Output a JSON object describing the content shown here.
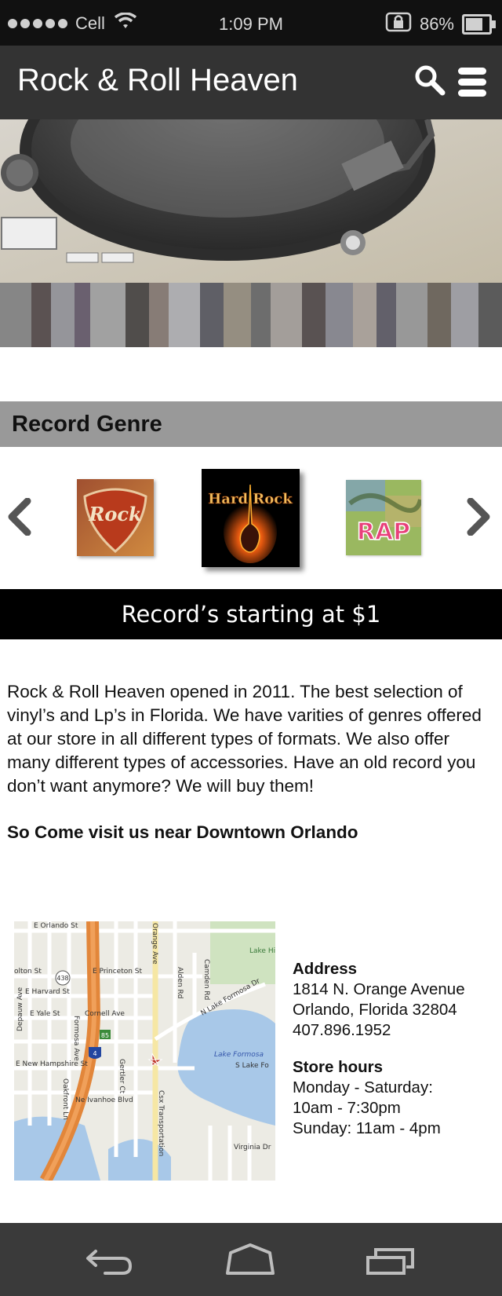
{
  "status_bar": {
    "carrier": "Cell",
    "time": "1:09 PM",
    "battery_percent": "86%",
    "battery_level": 0.86
  },
  "header": {
    "title": "Rock & Roll Heaven"
  },
  "genre": {
    "title": "Record Genre",
    "items": [
      {
        "label": "Rock"
      },
      {
        "label": "Hard Rock"
      },
      {
        "label": "RAP"
      }
    ]
  },
  "promo": {
    "text": "Record’s starting at $1"
  },
  "about": {
    "text": "Rock & Roll Heaven opened in 2011. The best selection of vinyl’s and Lp’s in Florida.  We have varities of genres offered at our store in all different types of formats. We also offer many different types of accessories. Have an old record you don’t want anymore? We will buy them!",
    "cta": "So Come visit us near Downtown Orlando"
  },
  "map": {
    "labels": {
      "e_orlando_st": "E Orlando St",
      "colton_st": "olton St",
      "route_438": "438",
      "e_princeton_st": "E Princeton St",
      "e_harvard_st": "E Harvard St",
      "e_yale_st": "E Yale St",
      "cornell_ave": "Cornell Ave",
      "depauw_ave": "Depauw Ave",
      "formosa_ave": "Formosa Ave",
      "e_new_hampshire_st": "E New Hampshire St",
      "oakfront_ln": "Oakfront Ln",
      "ne_ivanhoe_blvd": "Ne Ivanhoe Blvd",
      "gertler_ct": "Gertler Ct",
      "csx_transportation": "Csx Transportation",
      "orange_ave": "Orange Ave",
      "alden_rd": "Alden Rd",
      "camden_rd": "Camden Rd",
      "n_lake_formosa_dr": "N Lake Formosa Dr",
      "lake_formosa": "Lake Formosa",
      "s_lake_formosa": "S Lake Fo",
      "virginia_dr": "Virginia Dr",
      "lake_highland_prep": "Lake Hi Pa",
      "highway_85": "85",
      "interstate_4": "4"
    }
  },
  "store": {
    "address_heading": "Address",
    "address_line1": "1814 N. Orange Avenue",
    "address_line2": "Orlando, Florida 32804",
    "phone": "407.896.1952",
    "hours_heading": "Store hours",
    "hours_line1": "Monday - Saturday:",
    "hours_line2": "10am - 7:30pm",
    "hours_line3": "Sunday: 11am - 4pm"
  },
  "colors": {
    "header_bg": "#333333",
    "status_bg": "#111111",
    "genre_bar": "#999999",
    "promo_bg": "#000000",
    "nav_bg": "#3a3a3a"
  },
  "icons": [
    "wifi-icon",
    "lock-rotation-icon",
    "battery-icon",
    "search-icon",
    "menu-icon",
    "chevron-left-icon",
    "chevron-right-icon",
    "back-icon",
    "home-icon",
    "recent-apps-icon"
  ]
}
